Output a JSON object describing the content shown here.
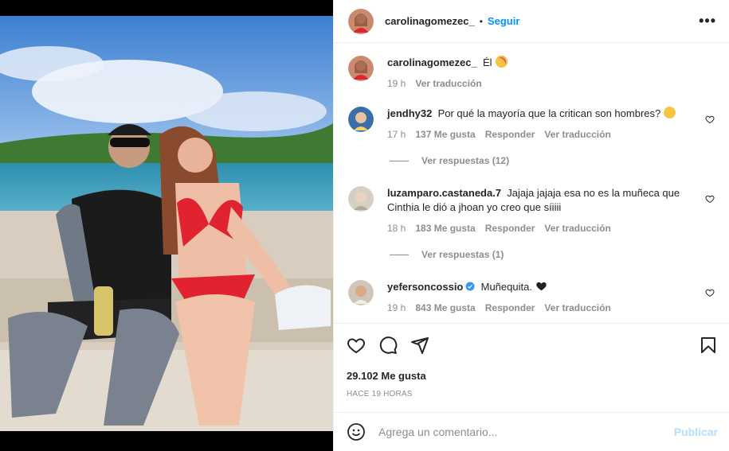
{
  "header": {
    "username": "carolinagomezec_",
    "separator": "•",
    "follow_label": "Seguir",
    "more_label": "•••"
  },
  "caption": {
    "username": "carolinagomezec_",
    "text": "Él",
    "emoji": "smiling-face-with-hearts",
    "time": "19 h",
    "translate_label": "Ver traducción"
  },
  "comments": [
    {
      "username": "jendhy32",
      "text": "Por qué la mayoría que la critican son hombres?",
      "emoji": "thinking-face",
      "time": "17 h",
      "likes": "137 Me gusta",
      "reply_label": "Responder",
      "translate_label": "Ver traducción",
      "replies_label": "Ver respuestas (12)"
    },
    {
      "username": "luzamparo.castaneda.7",
      "text": "Jajaja jajaja esa no es la muñeca que Cinthia le dió a jhoan yo creo que síiiii",
      "time": "18 h",
      "likes": "183 Me gusta",
      "reply_label": "Responder",
      "translate_label": "Ver traducción",
      "replies_label": "Ver respuestas (1)"
    },
    {
      "username": "yefersoncossio",
      "verified": true,
      "text": "Muñequita.",
      "emoji": "black-heart",
      "time": "19 h",
      "likes": "843 Me gusta",
      "reply_label": "Responder",
      "translate_label": "Ver traducción"
    }
  ],
  "actions": {
    "likes": "29.102 Me gusta",
    "posted": "HACE 19 HORAS"
  },
  "add_comment": {
    "placeholder": "Agrega un comentario...",
    "post_label": "Publicar"
  },
  "colors": {
    "accent": "#0095f6",
    "post_disabled": "#b2dffc",
    "muted": "#8e8e8e",
    "text": "#262626",
    "verified": "#3897f0"
  }
}
